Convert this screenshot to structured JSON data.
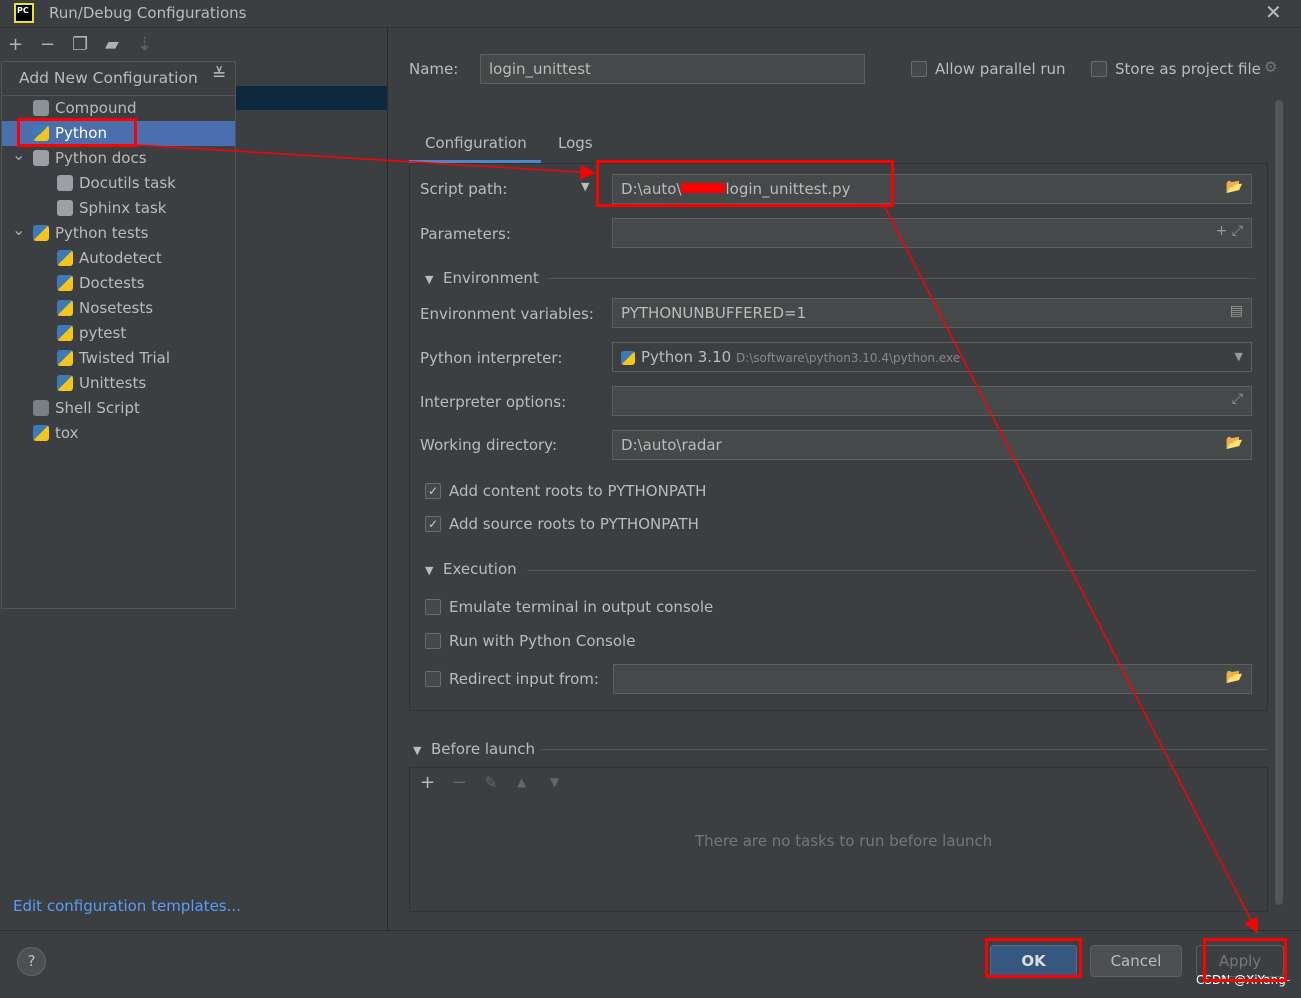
{
  "window": {
    "title": "Run/Debug Configurations",
    "logo_text": "PC",
    "close_icon": "close-icon"
  },
  "toolbar": {
    "icons": [
      "plus-icon",
      "minus-icon",
      "copy-icon",
      "new-folder-icon",
      "sort-icon"
    ]
  },
  "popup": {
    "title": "Add New Configuration",
    "items": [
      {
        "label": "Compound",
        "icon": "compound-icon",
        "level": 0
      },
      {
        "label": "Python",
        "icon": "python-icon",
        "level": 0,
        "selected": true
      },
      {
        "label": "Python docs",
        "icon": "rst-icon",
        "level": 0,
        "expanded": true
      },
      {
        "label": "Docutils task",
        "icon": "rst-icon",
        "level": 1
      },
      {
        "label": "Sphinx task",
        "icon": "rst-icon",
        "level": 1
      },
      {
        "label": "Python tests",
        "icon": "python-tests-icon",
        "level": 0,
        "expanded": true
      },
      {
        "label": "Autodetect",
        "icon": "python-tests-icon",
        "level": 1
      },
      {
        "label": "Doctests",
        "icon": "python-tests-icon",
        "level": 1
      },
      {
        "label": "Nosetests",
        "icon": "python-tests-icon",
        "level": 1
      },
      {
        "label": "pytest",
        "icon": "python-tests-icon",
        "level": 1
      },
      {
        "label": "Twisted Trial",
        "icon": "python-tests-icon",
        "level": 1
      },
      {
        "label": "Unittests",
        "icon": "python-tests-icon",
        "level": 1
      },
      {
        "label": "Shell Script",
        "icon": "shell-icon",
        "level": 0
      },
      {
        "label": "tox",
        "icon": "python-tests-icon",
        "level": 0
      }
    ]
  },
  "edit_templates_link": "Edit configuration templates...",
  "header": {
    "name_label": "Name:",
    "name_value": "login_unittest",
    "allow_parallel": "Allow parallel run",
    "store_project": "Store as project file"
  },
  "tabs": [
    "Configuration",
    "Logs"
  ],
  "form": {
    "script_path_label": "Script path:",
    "script_path_value": "D:\\auto\\radar\\login_unittest.py",
    "script_path_prefix": "D:\\auto\\",
    "script_path_suffix": "login_unittest.py",
    "parameters_label": "Parameters:",
    "environment_section": "Environment",
    "env_vars_label": "Environment variables:",
    "env_vars_value": "PYTHONUNBUFFERED=1",
    "interpreter_label": "Python interpreter:",
    "interpreter_name": "Python 3.10",
    "interpreter_path": "D:\\software\\python3.10.4\\python.exe",
    "interp_options_label": "Interpreter options:",
    "working_dir_label": "Working directory:",
    "working_dir_value": "D:\\auto\\radar",
    "content_roots": "Add content roots to PYTHONPATH",
    "source_roots": "Add source roots to PYTHONPATH",
    "execution_section": "Execution",
    "emulate_terminal": "Emulate terminal in output console",
    "run_console": "Run with Python Console",
    "redirect_input": "Redirect input from:"
  },
  "before_launch": {
    "title": "Before launch",
    "empty": "There are no tasks to run before launch"
  },
  "buttons": {
    "ok": "OK",
    "cancel": "Cancel",
    "apply": "Apply",
    "help": "?"
  },
  "watermark": "CSDN @XiYang-",
  "annotation_color": "#ff0000"
}
